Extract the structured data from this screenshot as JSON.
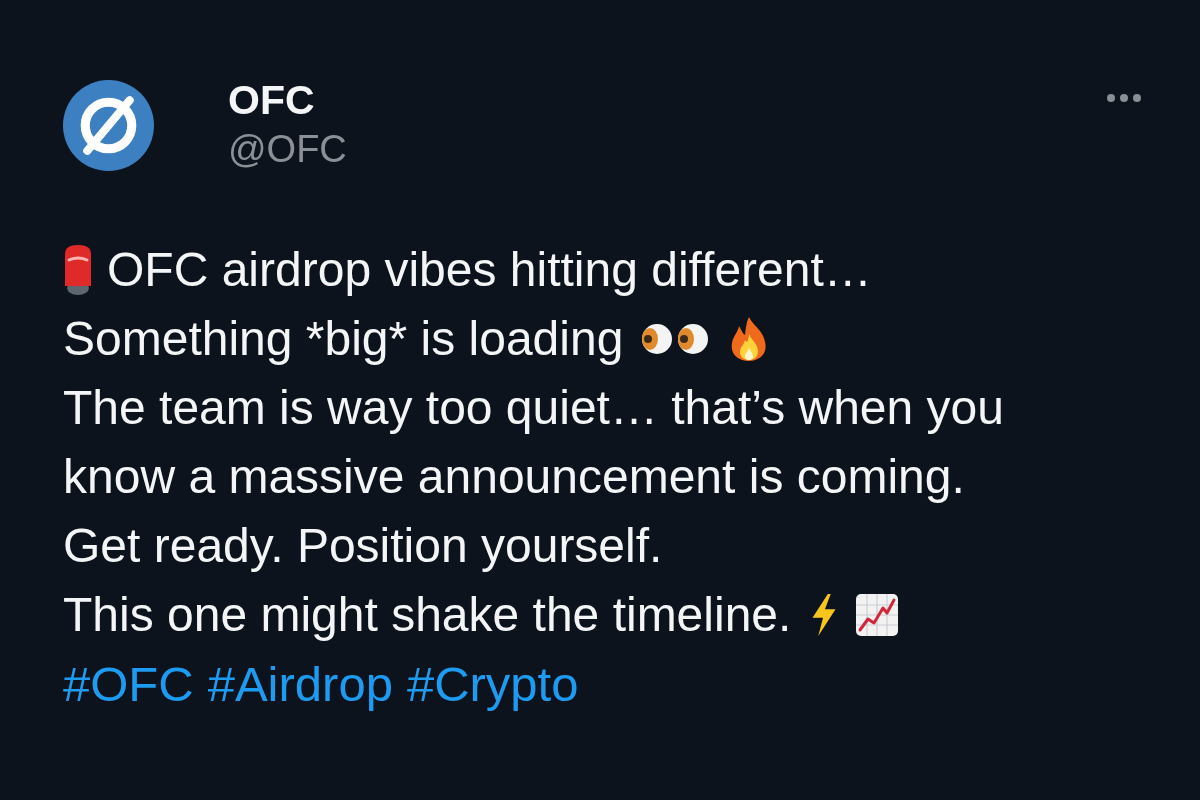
{
  "post": {
    "author": {
      "name": "OFC",
      "handle": "@OFC"
    },
    "lines": [
      [
        {
          "kind": "siren"
        },
        {
          "kind": "text",
          "text": "OFC airdrop vibes hitting different…"
        }
      ],
      [
        {
          "kind": "text",
          "text": "Something *big* is loading"
        },
        {
          "kind": "eyes"
        },
        {
          "kind": "fire"
        }
      ],
      [
        {
          "kind": "text",
          "text": "The team is way too quiet… that’s when you"
        }
      ],
      [
        {
          "kind": "text",
          "text": "know a massive announcement is coming."
        }
      ],
      [
        {
          "kind": "text",
          "text": "Get ready. Position yourself."
        }
      ],
      [
        {
          "kind": "text",
          "text": "This one might shake the timeline."
        },
        {
          "kind": "lightning"
        },
        {
          "kind": "chart"
        }
      ]
    ],
    "hashtags": [
      "#OFC",
      "#Airdrop",
      "#Crypto"
    ]
  }
}
